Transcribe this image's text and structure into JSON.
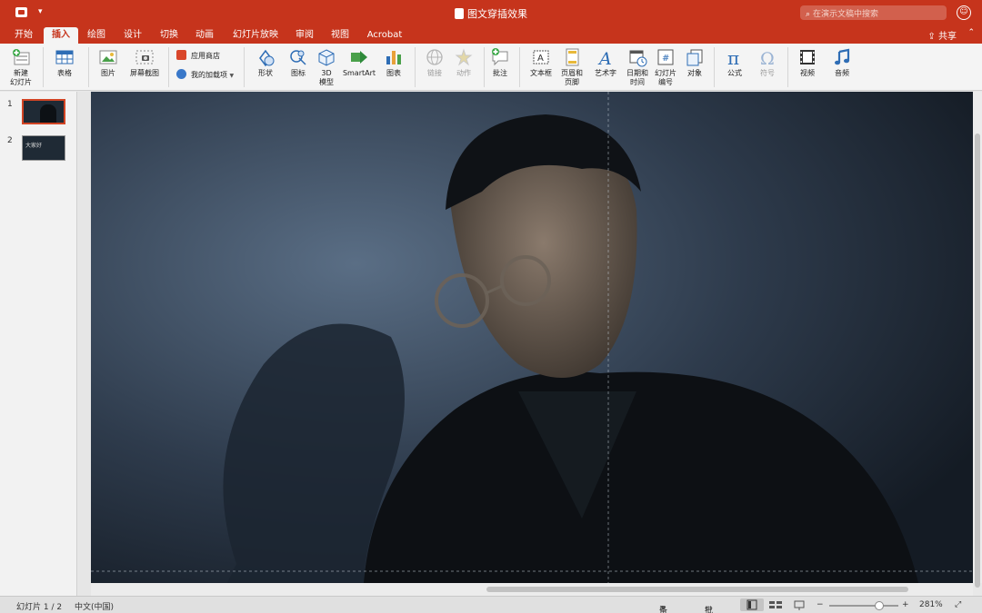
{
  "window": {
    "document_title": "图文穿插效果",
    "search_placeholder": "在演示文稿中搜索"
  },
  "tabs": [
    {
      "label": "开始",
      "active": false
    },
    {
      "label": "插入",
      "active": true
    },
    {
      "label": "绘图",
      "active": false
    },
    {
      "label": "设计",
      "active": false
    },
    {
      "label": "切换",
      "active": false
    },
    {
      "label": "动画",
      "active": false
    },
    {
      "label": "幻灯片放映",
      "active": false
    },
    {
      "label": "审阅",
      "active": false
    },
    {
      "label": "视图",
      "active": false
    },
    {
      "label": "Acrobat",
      "active": false
    }
  ],
  "share_label": "共享",
  "ribbon": {
    "new_slide": [
      "新建",
      "幻灯片"
    ],
    "table": "表格",
    "picture": "图片",
    "screenshot": "屏幕截图",
    "app_store": "应用商店",
    "my_addins": "我的加载项",
    "shapes": "形状",
    "icons": "图标",
    "model_3d": [
      "3D",
      "模型"
    ],
    "smartart": "SmartArt",
    "chart": "图表",
    "link": "链接",
    "action": "动作",
    "comment": "批注",
    "textbox": "文本框",
    "header_footer": [
      "页眉和",
      "页脚"
    ],
    "wordart": "艺术字",
    "datetime": [
      "日期和",
      "时间"
    ],
    "slide_number": [
      "幻灯片",
      "编号"
    ],
    "object": "对象",
    "equation": "公式",
    "symbol": "符号",
    "video": "视频",
    "audio": "音频"
  },
  "slides": [
    {
      "number": "1",
      "selected": true
    },
    {
      "number": "2",
      "selected": false,
      "thumb_text": "大家好"
    }
  ],
  "status": {
    "slide_counter": "幻灯片 1 / 2",
    "language": "中文(中国)",
    "notes": "备注",
    "comments": "批注",
    "zoom": "281%",
    "zoom_fraction": 0.72
  },
  "colors": {
    "accent": "#c6341c",
    "ribbon_bg": "#f4f4f4"
  }
}
